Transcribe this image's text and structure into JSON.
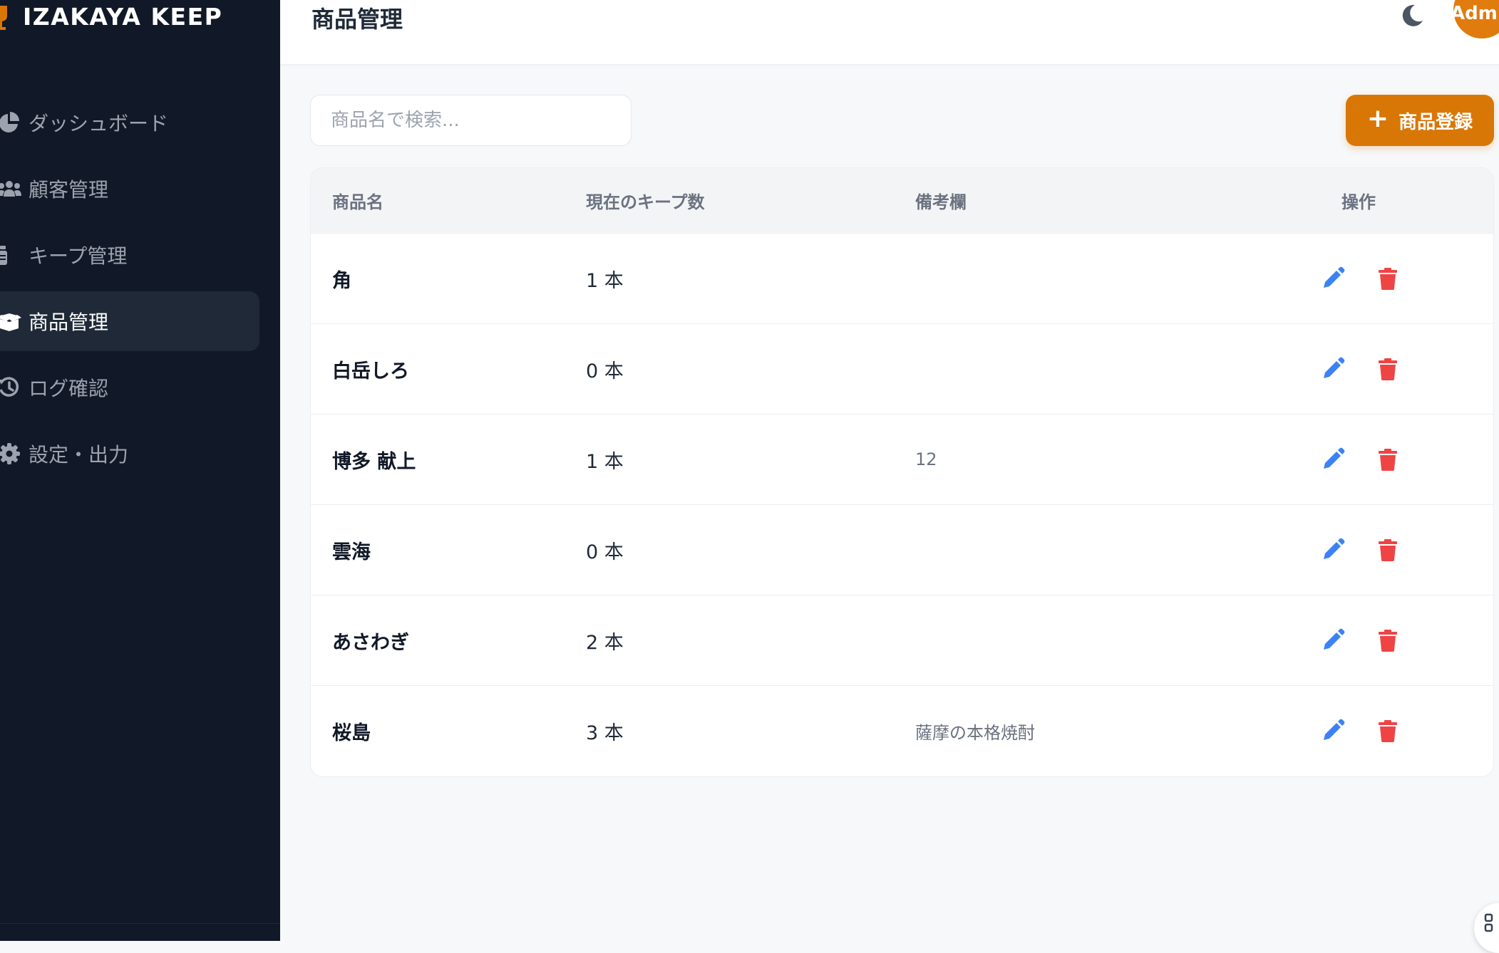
{
  "app": {
    "brand": "IZAKAYA KEEP"
  },
  "sidebar": {
    "items": [
      {
        "label": "ダッシュボード",
        "icon": "pie-chart-icon"
      },
      {
        "label": "顧客管理",
        "icon": "users-icon"
      },
      {
        "label": "キープ管理",
        "icon": "bottle-icon"
      },
      {
        "label": "商品管理",
        "icon": "box-open-icon",
        "active": true
      },
      {
        "label": "ログ確認",
        "icon": "history-icon"
      },
      {
        "label": "設定・出力",
        "icon": "gear-icon"
      }
    ]
  },
  "header": {
    "title": "商品管理",
    "user": "Admin"
  },
  "toolbar": {
    "search_placeholder": "商品名で検索...",
    "add_label": "商品登録"
  },
  "table": {
    "headers": {
      "name": "商品名",
      "count": "現在のキープ数",
      "note": "備考欄",
      "actions": "操作"
    },
    "rows": [
      {
        "name": "角",
        "count": "1 本",
        "note": ""
      },
      {
        "name": "白岳しろ",
        "count": "0 本",
        "note": ""
      },
      {
        "name": "博多 献上",
        "count": "1 本",
        "note": "12"
      },
      {
        "name": "雲海",
        "count": "0 本",
        "note": ""
      },
      {
        "name": "あさわぎ",
        "count": "2 本",
        "note": ""
      },
      {
        "name": "桜島",
        "count": "3 本",
        "note": "薩摩の本格焼酎"
      }
    ]
  },
  "colors": {
    "sidebar_bg": "#111827",
    "accent": "#d97706",
    "edit": "#3b82f6",
    "delete": "#ef4444"
  }
}
